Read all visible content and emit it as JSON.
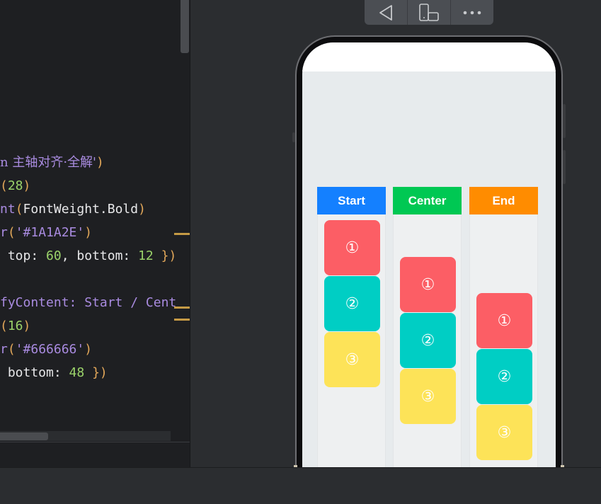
{
  "colors": {
    "editor_bg": "#1e1f22",
    "preview_bg": "#2b2d30",
    "screen_bg": "#e7ebed",
    "start": "#1480ff",
    "center": "#00c853",
    "end": "#ff8c00",
    "box1": "#fc5e65",
    "box2": "#00cec4",
    "box3": "#fde358"
  },
  "editor": {
    "lines": [
      {
        "tokens": [
          [
            "n 主轴对齐·全解'",
            "cn"
          ],
          [
            ")",
            "paren"
          ]
        ]
      },
      {
        "tokens": [
          [
            "(",
            "paren"
          ],
          [
            "28",
            "num"
          ],
          [
            ")",
            "paren"
          ]
        ]
      },
      {
        "tokens": [
          [
            "nt",
            "fn"
          ],
          [
            "(",
            "paren"
          ],
          [
            "FontWeight.Bold",
            "plain"
          ],
          [
            ")",
            "paren"
          ]
        ]
      },
      {
        "tokens": [
          [
            "r",
            "fn"
          ],
          [
            "(",
            "paren"
          ],
          [
            "'#1A1A2E'",
            "str"
          ],
          [
            ")",
            "paren"
          ]
        ]
      },
      {
        "tokens": [
          [
            " top: ",
            "plain"
          ],
          [
            "60",
            "num"
          ],
          [
            ", bottom: ",
            "plain"
          ],
          [
            "12",
            "num"
          ],
          [
            " })",
            "paren"
          ]
        ]
      },
      {
        "tokens": [
          [
            "",
            "plain"
          ]
        ]
      },
      {
        "tokens": [
          [
            "fyContent: Start / Cent",
            "fn"
          ]
        ]
      },
      {
        "tokens": [
          [
            "(",
            "paren"
          ],
          [
            "16",
            "num"
          ],
          [
            ")",
            "paren"
          ]
        ]
      },
      {
        "tokens": [
          [
            "r",
            "fn"
          ],
          [
            "(",
            "paren"
          ],
          [
            "'#666666'",
            "str"
          ],
          [
            ")",
            "paren"
          ]
        ]
      },
      {
        "tokens": [
          [
            " bottom: ",
            "plain"
          ],
          [
            "48",
            "num"
          ],
          [
            " })",
            "paren"
          ]
        ]
      }
    ]
  },
  "toolbar": {
    "back_icon": "back-triangle-icon",
    "device_icon": "device-rotate-icon",
    "more_icon": "more-dots-icon"
  },
  "preview": {
    "columns": [
      {
        "label": "Start",
        "align": "start",
        "items": [
          "①",
          "②",
          "③"
        ]
      },
      {
        "label": "Center",
        "align": "center",
        "items": [
          "①",
          "②",
          "③"
        ]
      },
      {
        "label": "End",
        "align": "end",
        "items": [
          "①",
          "②",
          "③"
        ]
      }
    ]
  }
}
